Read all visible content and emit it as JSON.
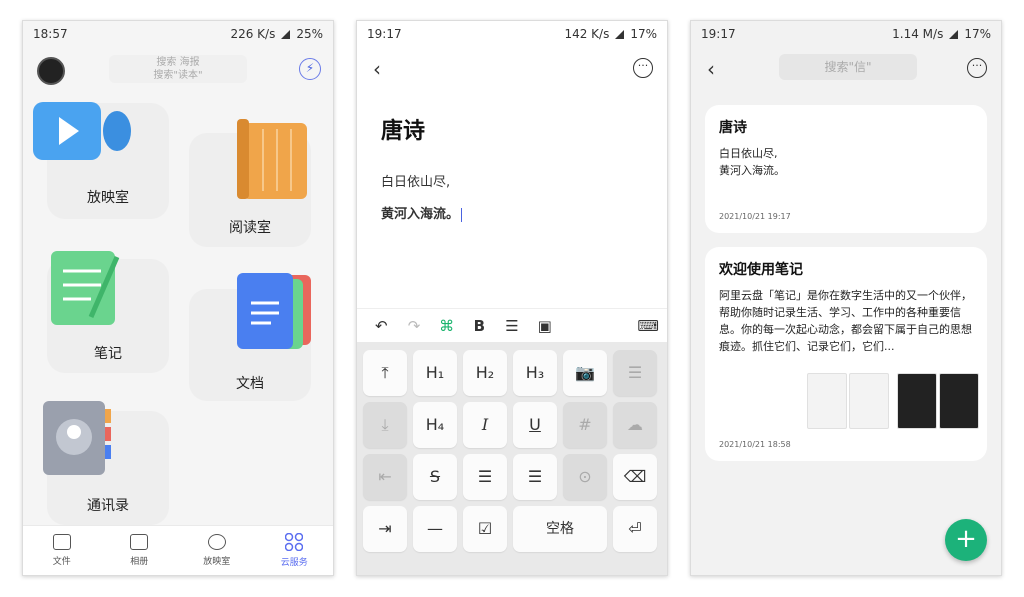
{
  "phone1": {
    "status": {
      "time": "18:57",
      "speed": "226 K/s",
      "battery": "25%"
    },
    "search_lines": [
      "搜索 海报",
      "搜索\"读本\""
    ],
    "cards": [
      {
        "label": "放映室",
        "icon": "video-camera-icon",
        "color": "#4aa3f0"
      },
      {
        "label": "阅读室",
        "icon": "book-icon",
        "color": "#f0a54a"
      },
      {
        "label": "笔记",
        "icon": "notebook-icon",
        "color": "#6ad48e"
      },
      {
        "label": "文档",
        "icon": "documents-icon",
        "color": "#4a7ff0"
      },
      {
        "label": "通讯录",
        "icon": "contacts-icon",
        "color": "#9aa0ad"
      }
    ],
    "tabs": [
      {
        "label": "文件",
        "icon": "folder-icon"
      },
      {
        "label": "相册",
        "icon": "photo-icon"
      },
      {
        "label": "放映室",
        "icon": "play-icon"
      },
      {
        "label": "云服务",
        "icon": "cloud-service-icon",
        "active": true
      }
    ]
  },
  "phone2": {
    "status": {
      "time": "19:17",
      "speed": "142 K/s",
      "battery": "17%"
    },
    "title": "唐诗",
    "lines": [
      "白日依山尽,",
      "黄河入海流。"
    ],
    "toolbar": [
      "undo-icon",
      "redo-icon",
      "command-icon",
      "bold-icon",
      "list-icon",
      "image-icon",
      "keyboard-icon"
    ],
    "toolbar_glyphs": [
      "↶",
      "↷",
      "⌘",
      "B",
      "☰",
      "▣",
      "⌨"
    ],
    "keys": [
      "⤒",
      "H₁",
      "H₂",
      "H₃",
      "📷",
      "☰",
      "⤓",
      "H₄",
      "I",
      "U",
      "#",
      "☁",
      "⇤",
      "S",
      "☰",
      "☰",
      "⊙",
      "⌫",
      "⇥",
      "—",
      "☑",
      "空格",
      "⏎"
    ]
  },
  "phone3": {
    "status": {
      "time": "19:17",
      "speed": "1.14 M/s",
      "battery": "17%"
    },
    "search_placeholder": "搜索\"信\"",
    "notes": [
      {
        "title": "唐诗",
        "body": "白日依山尽,\n黄河入海流。",
        "date": "2021/10/21 19:17"
      },
      {
        "title": "欢迎使用笔记",
        "body": "阿里云盘「笔记」是你在数字生活中的又一个伙伴，帮助你随时记录生活、学习、工作中的各种重要信息。你的每一次起心动念，都会留下属于自己的思想痕迹。抓住它们、记录它们，它们...",
        "date": "2021/10/21 18:58"
      }
    ],
    "fab": "+"
  },
  "colors": {
    "accent": "#5b6ef0",
    "fab": "#1cb27a",
    "green": "#18b36c"
  }
}
